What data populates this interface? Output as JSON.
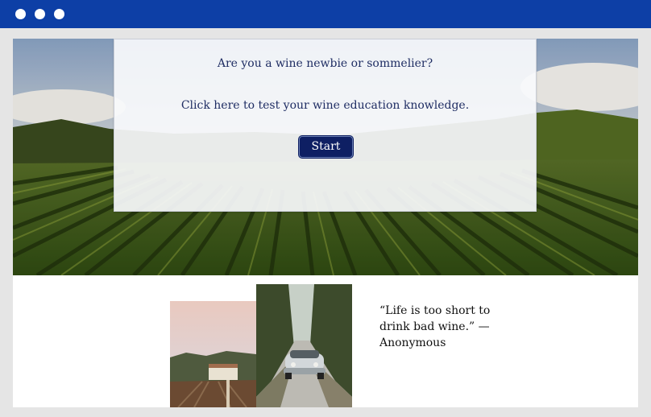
{
  "window": {
    "titlebar_color": "#0d3fa6",
    "controls": [
      "dot-icon",
      "dot-icon",
      "dot-icon"
    ]
  },
  "hero": {
    "image": "vineyard-landscape",
    "modal": {
      "question": "Are you a wine newbie or sommelier?",
      "prompt": "Click here to test your wine education knowledge.",
      "start_label": "Start"
    }
  },
  "gallery": {
    "images": [
      "estate-vineyard-photo",
      "vintage-car-photo"
    ]
  },
  "quote": {
    "text": "“Life is too short to drink bad wine.” — Anonymous"
  },
  "colors": {
    "accent": "#0d3fa6",
    "button": "#0e1f63",
    "text_dark": "#1f2d63"
  }
}
